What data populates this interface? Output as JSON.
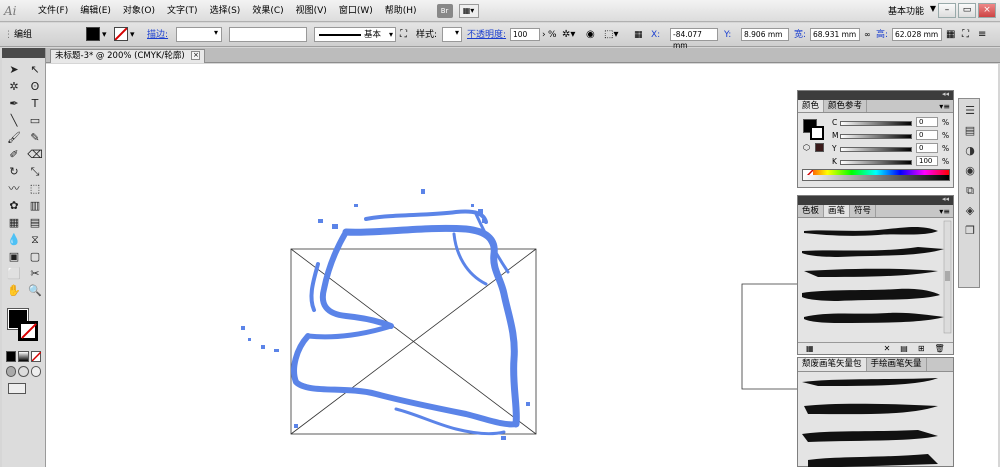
{
  "app": {
    "logo": "Ai"
  },
  "menu": [
    "文件(F)",
    "编辑(E)",
    "对象(O)",
    "文字(T)",
    "选择(S)",
    "效果(C)",
    "视图(V)",
    "窗口(W)",
    "帮助(H)"
  ],
  "bridge_badge": "Br",
  "workspace": {
    "label": "基本功能",
    "arrow": "▼"
  },
  "window_buttons": [
    "–",
    "▭",
    "×"
  ],
  "control": {
    "mode_label": "编组",
    "stroke_label": "描边:",
    "brush_label": "基本",
    "style_label": "样式:",
    "opacity_label": "不透明度:",
    "opacity_value": "100",
    "opacity_unit": "%",
    "x_label": "X:",
    "x_value": "-84.077 mm",
    "y_label": "Y:",
    "y_value": "8.906 mm",
    "w_label": "宽:",
    "w_value": "68.931 mm",
    "h_label": "高:",
    "h_value": "62.028 mm",
    "colors": {
      "fill": "#000000",
      "stroke_none": "#d40000",
      "link": "#1b3fd0"
    }
  },
  "document": {
    "tab_title": "未标题-3* @ 200% (CMYK/轮廓)",
    "close": "×"
  },
  "tools": [
    "selection-icon",
    "direct-selection-icon",
    "magic-wand-icon",
    "lasso-icon",
    "pen-icon",
    "type-icon",
    "line-icon",
    "rectangle-icon",
    "paintbrush-icon",
    "pencil-icon",
    "blob-brush-icon",
    "eraser-icon",
    "rotate-icon",
    "scale-icon",
    "warp-icon",
    "free-transform-icon",
    "symbol-sprayer-icon",
    "column-graph-icon",
    "mesh-icon",
    "gradient-icon",
    "eyedropper-icon",
    "blend-icon",
    "live-paint-icon",
    "live-paint-select-icon",
    "artboard-icon",
    "slice-icon",
    "hand-icon",
    "zoom-icon"
  ],
  "tool_glyphs": [
    "➤",
    "↖",
    "✲",
    "ʘ",
    "✒",
    "T",
    "╲",
    "▭",
    "🖌",
    "✎",
    "✐",
    "⌫",
    "↻",
    "⤡",
    "〰",
    "⬚",
    "✿",
    "▥",
    "▦",
    "▤",
    "💧",
    "⧖",
    "▣",
    "▢",
    "⬜",
    "✂",
    "✋",
    "🔍"
  ],
  "color_panel": {
    "tabs": [
      "颜色",
      "颜色参考"
    ],
    "channels": [
      {
        "label": "C",
        "value": "0",
        "unit": "%"
      },
      {
        "label": "M",
        "value": "0",
        "unit": "%"
      },
      {
        "label": "Y",
        "value": "0",
        "unit": "%"
      },
      {
        "label": "K",
        "value": "100",
        "unit": "%"
      }
    ]
  },
  "brush_panel": {
    "tabs": [
      "色板",
      "画笔",
      "符号"
    ]
  },
  "library_panel": {
    "tabs": [
      "颓废画笔矢量包",
      "手绘画笔矢量"
    ]
  },
  "panel_arrows": "◂◂",
  "panel_menu": "▾≡",
  "strip_icons": [
    "☰",
    "▤",
    "◑",
    "◉",
    "⧉",
    "◈",
    "❐"
  ],
  "colors": {
    "selection_blue": "#5b84e8",
    "panel_dark": "#3c3c3c"
  }
}
